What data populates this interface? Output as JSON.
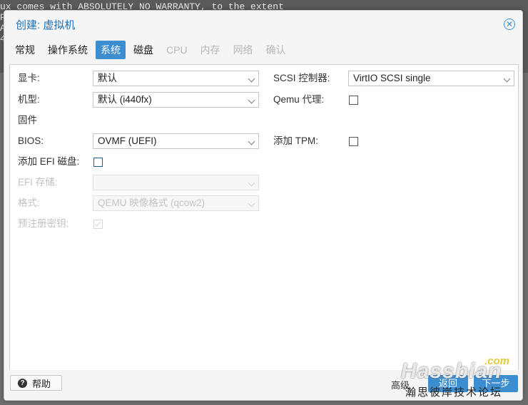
{
  "terminal": {
    "lines": [
      "ux comes with ABSOLUTELY NO WARRANTY, to the extent",
      "PP",
      "A",
      "40"
    ]
  },
  "dialog": {
    "title": "创建: 虚拟机",
    "close_icon": "close-circle-icon"
  },
  "tabs": [
    {
      "label": "常规",
      "state": "normal"
    },
    {
      "label": "操作系统",
      "state": "normal"
    },
    {
      "label": "系统",
      "state": "active"
    },
    {
      "label": "磁盘",
      "state": "normal"
    },
    {
      "label": "CPU",
      "state": "disabled"
    },
    {
      "label": "内存",
      "state": "disabled"
    },
    {
      "label": "网络",
      "state": "disabled"
    },
    {
      "label": "确认",
      "state": "disabled"
    }
  ],
  "form": {
    "graphics": {
      "label": "显卡:",
      "value": "默认"
    },
    "machine": {
      "label": "机型:",
      "value": "默认 (i440fx)"
    },
    "firmware_section": "固件",
    "bios": {
      "label": "BIOS:",
      "value": "OVMF (UEFI)"
    },
    "add_efi": {
      "label": "添加 EFI 磁盘:",
      "checked": false
    },
    "efi_storage": {
      "label": "EFI 存储:",
      "value": ""
    },
    "format": {
      "label": "格式:",
      "value": "QEMU 映像格式 (qcow2)"
    },
    "pre_enrolled_keys": {
      "label": "预注册密钥:",
      "checked": true
    },
    "scsi_controller": {
      "label": "SCSI 控制器:",
      "value": "VirtIO SCSI single"
    },
    "qemu_agent": {
      "label": "Qemu 代理:",
      "checked": false
    },
    "add_tpm": {
      "label": "添加 TPM:",
      "checked": false
    }
  },
  "footer": {
    "help_label": "帮助",
    "advanced_label": "高级",
    "back_label": "返回",
    "next_label": "下一步"
  },
  "watermark": {
    "com": ".com",
    "main": "Hassbian",
    "sub": "瀚思彼岸技术论坛"
  },
  "colors": {
    "accent": "#3d8ed1",
    "title": "#1f6fb2"
  }
}
